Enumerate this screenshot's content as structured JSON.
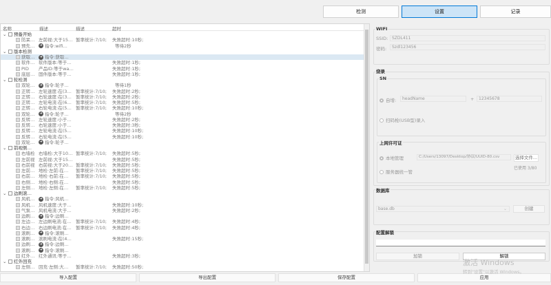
{
  "tabs": [
    {
      "label": "检测"
    },
    {
      "label": "设置",
      "selected": true
    },
    {
      "label": "记录"
    }
  ],
  "tree": {
    "headers": [
      "名称",
      "描述",
      "描述",
      "超时"
    ],
    "rows": [
      {
        "g": 1,
        "name": "预备开始"
      },
      {
        "name": "防呆…",
        "d1": "左前视:大于15…",
        "d2": "暂率统计:7/10;",
        "t": "失败超时:10秒;"
      },
      {
        "name": "预先…",
        "cmd": 1,
        "d1": "指令:wifi…",
        "t": "等待2秒",
        "wait": 1
      },
      {
        "g": 1,
        "name": "版本检测"
      },
      {
        "name": "获取…",
        "cmd": 1,
        "d1": "指令:获取…",
        "sel": 1
      },
      {
        "name": "软件…",
        "d1": "软件版本:等于…",
        "t": "失败超时:1秒;"
      },
      {
        "name": "PID",
        "d1": "产品ID:等于wa…",
        "t": "失败超时:1秒;"
      },
      {
        "name": "底层…",
        "d1": "固件版本:等于…",
        "t": "失败超时:1秒;"
      },
      {
        "g": 1,
        "name": "轮检测"
      },
      {
        "name": "双轮…",
        "cmd": 1,
        "d1": "指令:轮子…",
        "t": "等待1秒",
        "wait": 1
      },
      {
        "name": "正转…",
        "d1": "左轮速度:在(3…",
        "d2": "暂率统计:7/10;",
        "t": "失败超时:2秒;"
      },
      {
        "name": "正转…",
        "d1": "右轮速度:在(3…",
        "d2": "暂率统计:7/10;",
        "t": "失败超时:2秒;"
      },
      {
        "name": "正转…",
        "d1": "左轮电流:在(6…",
        "d2": "暂率统计:7/10;",
        "t": "失败超时:5秒;"
      },
      {
        "name": "正转…",
        "d1": "右轮电流:在(5…",
        "d2": "暂率统计:7/10;",
        "t": "失败超时:10秒;"
      },
      {
        "name": "双轮…",
        "cmd": 1,
        "d1": "指令:轮子…",
        "t": "等待2秒",
        "wait": 1
      },
      {
        "name": "反转…",
        "d1": "左轮速度:小于…",
        "t": "失败超时:2秒;"
      },
      {
        "name": "反转…",
        "d1": "右轮速度:小于…",
        "t": "失败超时:3秒;"
      },
      {
        "name": "反转…",
        "d1": "左轮电流:在(5…",
        "t": "失败超时:10秒;"
      },
      {
        "name": "反转…",
        "d1": "右轮电流:在(5…",
        "t": "失败超时:10秒;"
      },
      {
        "name": "双轮…",
        "cmd": 1,
        "d1": "指令:轮子…"
      },
      {
        "g": 1,
        "name": "前视侧…"
      },
      {
        "name": "右墙检",
        "d1": "右墙检:大于10…",
        "d2": "暂率统计:7/10;",
        "t": "失败超时:5秒;"
      },
      {
        "name": "左前视",
        "d1": "左前视:大于15…",
        "t": "失败超时:5秒;"
      },
      {
        "name": "右前视",
        "d1": "右前视:大于20…",
        "d2": "暂率统计:7/10;",
        "t": "失败超时:5秒;"
      },
      {
        "name": "左前…",
        "d1": "地检·左前:在…",
        "d2": "暂率统计:7/10;",
        "t": "失败超时:5秒;"
      },
      {
        "name": "右前…",
        "d1": "地检·右前:在…",
        "d2": "暂率统计:7/10;",
        "t": "失败超时:5秒;"
      },
      {
        "name": "右侧…",
        "d1": "地检·右侧:在…",
        "t": "失败超时:5秒;"
      },
      {
        "name": "左侧…",
        "d1": "地检·左侧:在…",
        "d2": "暂率统计:7/10;",
        "t": "失败超时:5秒;"
      },
      {
        "g": 1,
        "name": "边刷滚…"
      },
      {
        "name": "风机…",
        "cmd": 1,
        "d1": "指令:风机…"
      },
      {
        "name": "风机…",
        "d1": "风机速度:大于…",
        "t": "失败超时:10秒;"
      },
      {
        "name": "气泵…",
        "d1": "风机电流:大于…",
        "t": "失败超时:2秒;"
      },
      {
        "name": "边刷…",
        "cmd": 1,
        "d1": "指令:边刷…"
      },
      {
        "name": "左边…",
        "d1": "左边刷电流:在…",
        "d2": "暂率统计:7/10;",
        "t": "失败超时:4秒;"
      },
      {
        "name": "右边…",
        "d1": "右边刷电流:在…",
        "d2": "暂率统计:7/10;",
        "t": "失败超时:4秒;"
      },
      {
        "name": "滚刷…",
        "cmd": 1,
        "d1": "指令:滚刷…"
      },
      {
        "name": "滚刷…",
        "d1": "滚刷电流:在(4…",
        "t": "失败超时:15秒;"
      },
      {
        "name": "边刷…",
        "cmd": 1,
        "d1": "指令:边刷…"
      },
      {
        "name": "滚刷…",
        "cmd": 1,
        "d1": "指令:滚刷…"
      },
      {
        "name": "红外…",
        "d1": "红外通讯:等于…",
        "t": "失败超时:3秒;"
      },
      {
        "g": 1,
        "name": "红外回充"
      },
      {
        "name": "左侧…",
        "d1": "回充·左侧:大…",
        "d2": "暂率统计:7/10;",
        "t": "失败超时:50秒;"
      }
    ]
  },
  "bottom": {
    "import": "导入配置",
    "export": "导出配置",
    "save": "保存配置",
    "apply": "应用"
  },
  "wifi": {
    "title": "WIFI",
    "ssid_label": "SSID:",
    "ssid": "SZDL411",
    "pwd_label": "密码:",
    "pwd": "Szdl123456"
  },
  "burn": {
    "title": "烧录",
    "sn": {
      "title": "SN",
      "auto_label": "自增:",
      "head": "headName",
      "plus": "+",
      "num": "12345678",
      "scan_label": "扫码枪(USB型)录入"
    },
    "license": {
      "title": "上网许可证",
      "local": "本地管理",
      "path": "C:/Users/13097/Desktop/协议/UUID-80.csv",
      "choose": "选择文件...",
      "used": "已使用 3/80",
      "server": "服务器统一管"
    }
  },
  "db": {
    "title": "数据库",
    "value": "base.db",
    "create": "创建"
  },
  "unlock": {
    "title": "配置解锁",
    "input": "",
    "lock": "加锁",
    "unlock": "解锁"
  },
  "watermark": {
    "line1": "激活 Windows",
    "line2": "转到\"设置\"以激活 Windows。"
  }
}
